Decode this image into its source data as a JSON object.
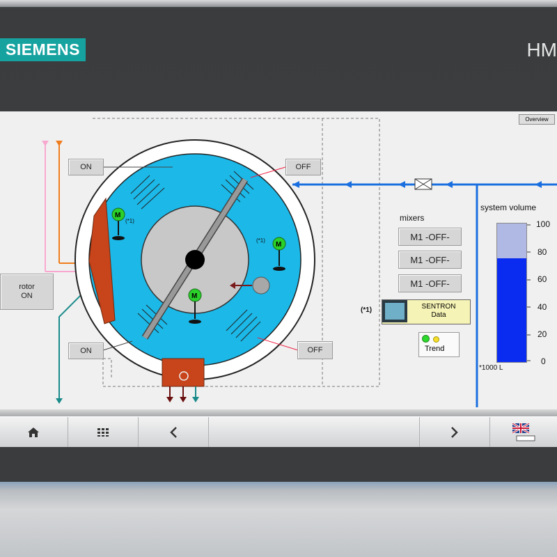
{
  "device": {
    "brand": "SIEMENS",
    "model": "HM"
  },
  "screen": {
    "overview_button": "Overview",
    "rotor_button": "rotor\nON",
    "on_button_top": "ON",
    "on_button_bottom": "ON",
    "off_button_top": "OFF",
    "off_button_bottom": "OFF",
    "motor_label": "M",
    "footnote_mark": "(*1)",
    "mixers_title": "mixers",
    "mixers": [
      "M1 -OFF-",
      "M1 -OFF-",
      "M1 -OFF-"
    ],
    "sentron_ref": "(*1)",
    "sentron_label": "SENTRON\nData",
    "trend_label": "Trend",
    "system_volume_title": "system volume",
    "volume_unit": "*1000 L",
    "volume_ticks": [
      "100",
      "80",
      "60",
      "40",
      "20",
      "0"
    ],
    "volume_level": 0.75
  },
  "navbar": {
    "home_icon": "home-icon",
    "grid_icon": "grid-icon",
    "back_icon": "chevron-left-icon",
    "forward_icon": "chevron-right-icon",
    "language_icon": "uk-flag-icon"
  },
  "colors": {
    "brand": "#16a3a0",
    "water": "#1bb8e8",
    "pipe_blue": "#1a6fe0",
    "tank_fill": "#0a2bf0"
  }
}
